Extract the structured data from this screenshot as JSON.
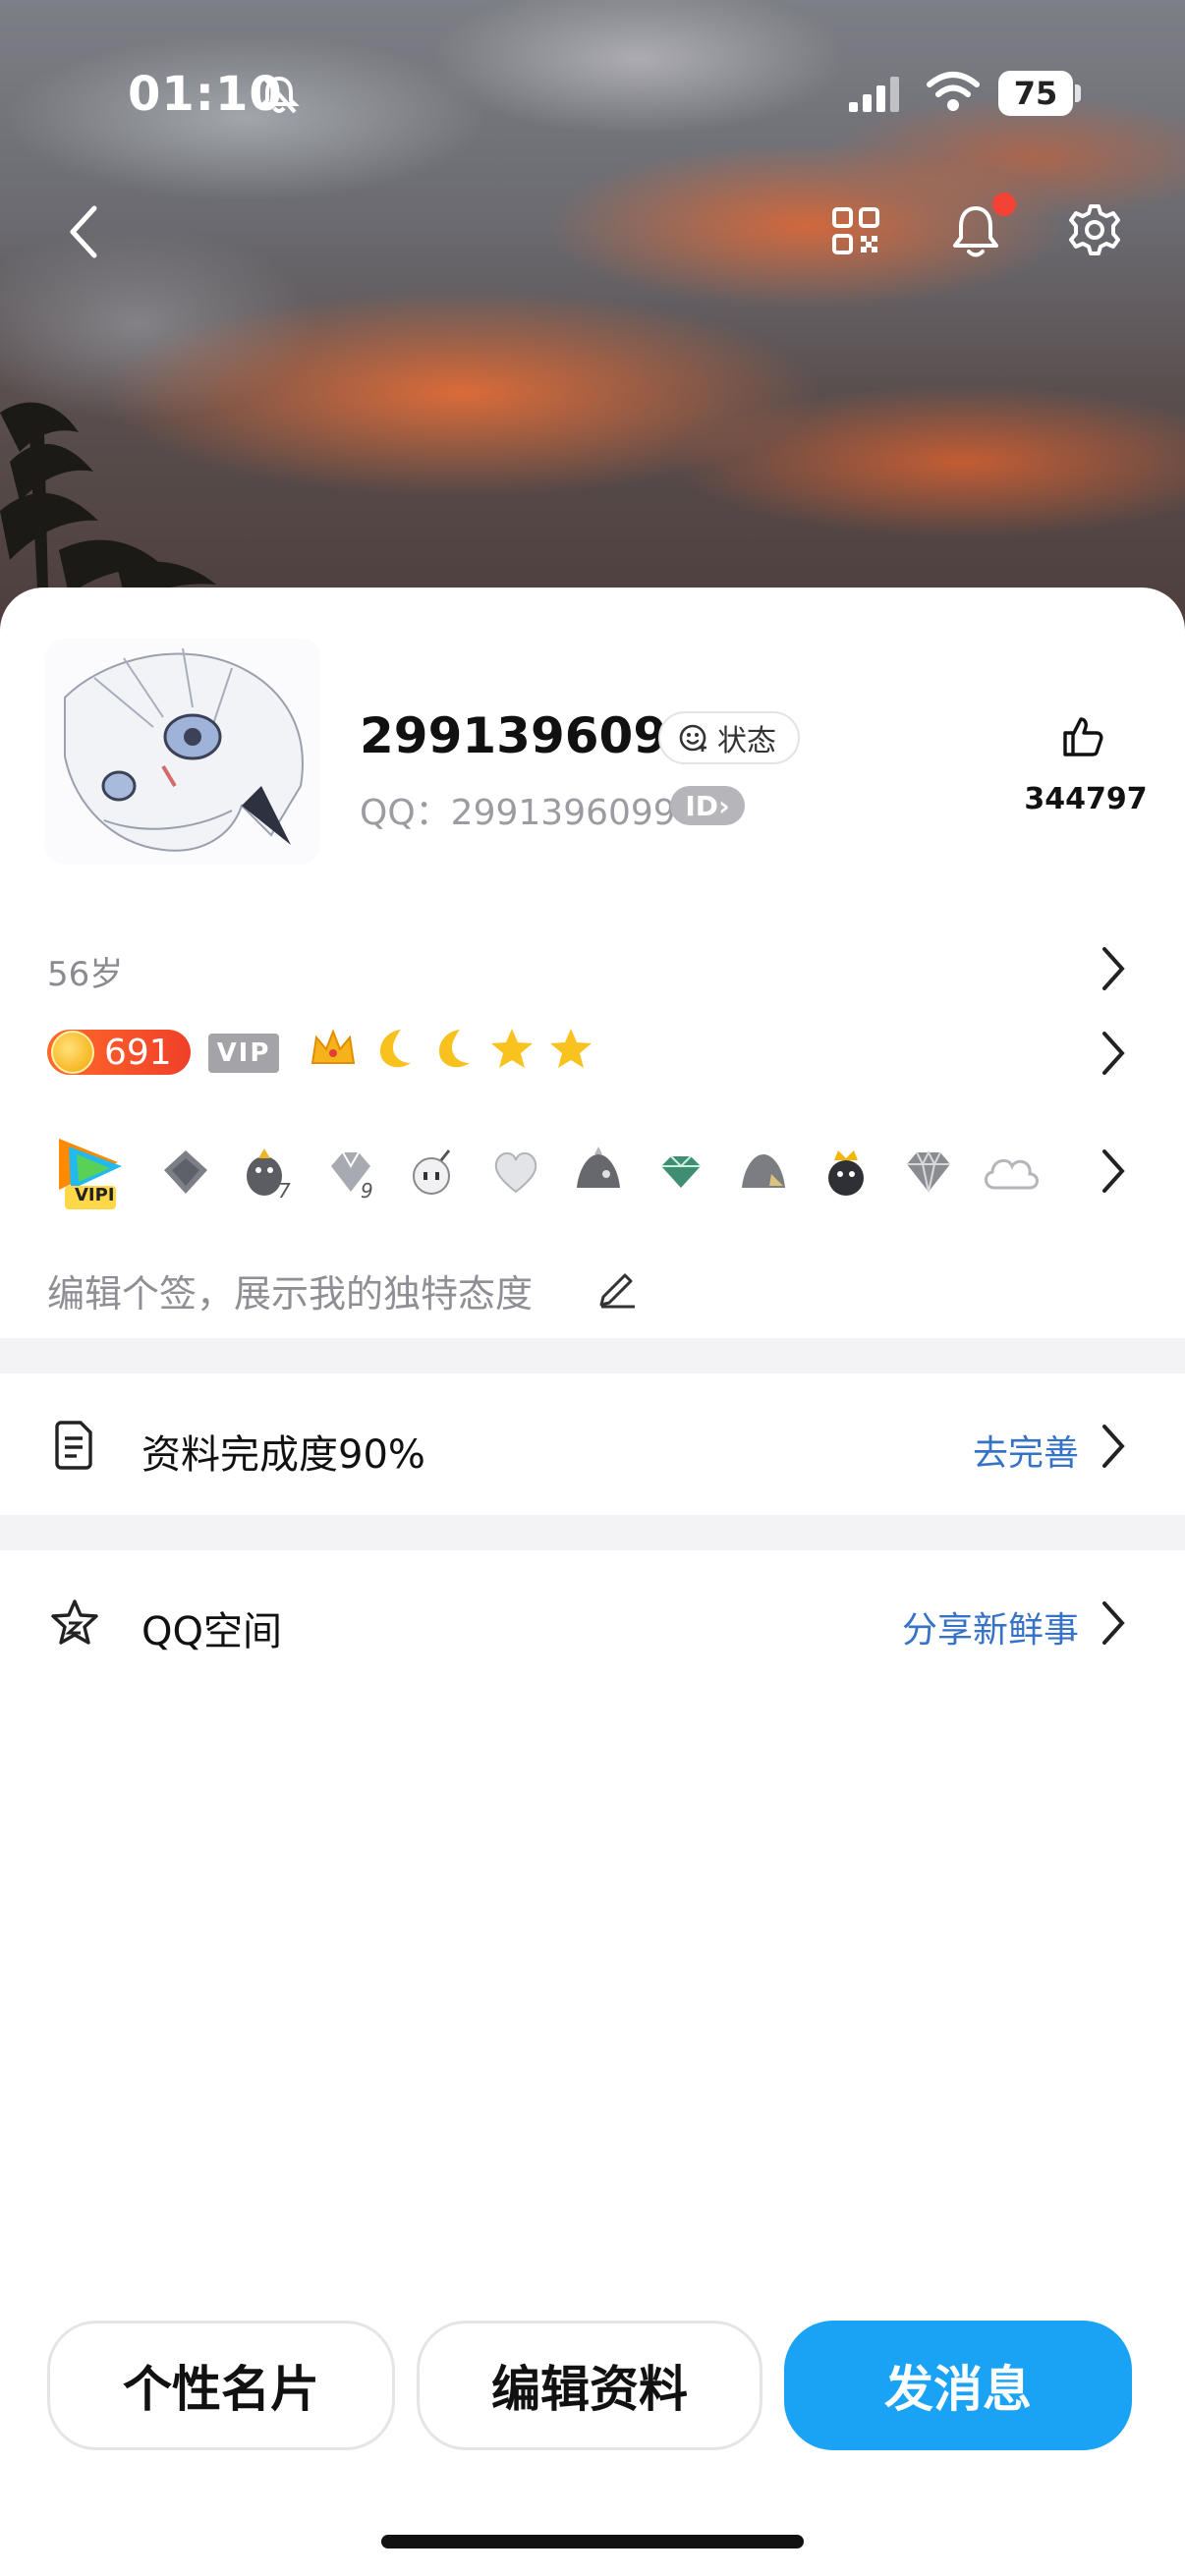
{
  "status_bar": {
    "time": "01:10",
    "battery": "75"
  },
  "profile": {
    "nickname": "2991396099",
    "status_label": "状态",
    "qq_line": "QQ：2991396099",
    "id_badge": "ID",
    "likes": "344797",
    "age": "56岁",
    "coin_level": "691",
    "vip_tag": "VIP",
    "vip_badge_label": "VIPI",
    "signature_placeholder": "编辑个签，展示我的独特态度"
  },
  "rows": [
    {
      "label": "资料完成度90%",
      "action": "去完善"
    },
    {
      "label": "QQ空间",
      "action": "分享新鲜事"
    }
  ],
  "buttons": {
    "card": "个性名片",
    "edit": "编辑资料",
    "message": "发消息"
  },
  "colors": {
    "primary_button": "#1aa3f5",
    "link": "#3673c6",
    "notification_dot": "#f44336"
  }
}
